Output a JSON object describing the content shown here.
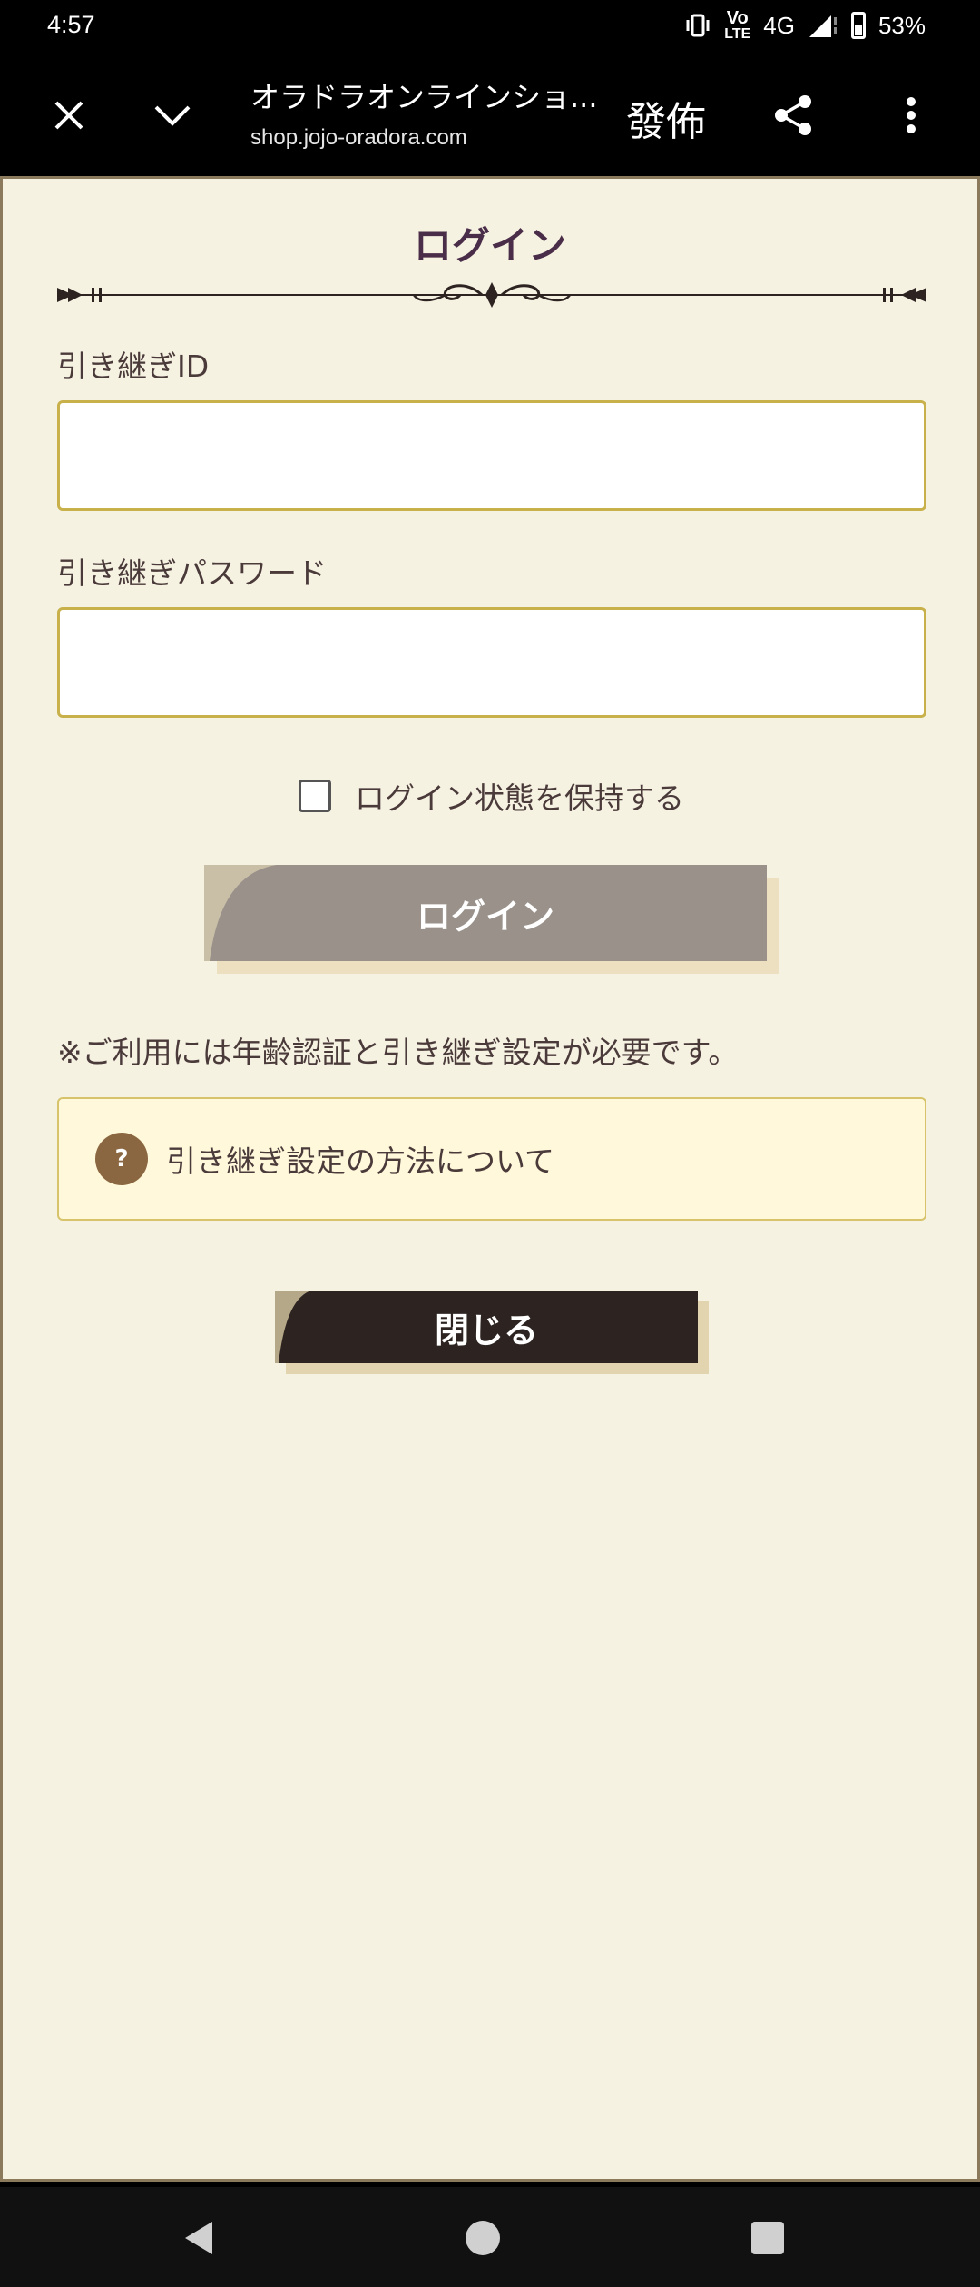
{
  "status_bar": {
    "time": "4:57",
    "network_top": "Vo",
    "network_bottom": "LTE",
    "network_type": "4G",
    "battery": "53%"
  },
  "toolbar": {
    "page_title": "オラドラオンラインショ...",
    "url": "shop.jojo-oradora.com",
    "translate_label": "發佈",
    "icons": [
      "close-icon",
      "chevron-down-icon",
      "share-icon",
      "more-vert-icon"
    ]
  },
  "login": {
    "title": "ログイン",
    "id_label": "引き継ぎID",
    "id_value": "",
    "password_label": "引き継ぎパスワード",
    "password_value": "",
    "remember_label": "ログイン状態を保持する",
    "remember_checked": false,
    "login_button": "ログイン",
    "note": "※ご利用には年齢認証と引き継ぎ設定が必要です。",
    "help_icon": "?",
    "help_label": "引き継ぎ設定の方法について",
    "close_button": "閉じる"
  },
  "colors": {
    "page_bg": "#f6f2e2",
    "title": "#4a2d48",
    "input_border": "#c8b14a",
    "login_button": "#99918a",
    "help_bg": "#fff8da",
    "help_icon": "#8b6741",
    "close_button": "#2d2421"
  },
  "navbar": {
    "icons": [
      "back-icon",
      "home-icon",
      "recents-icon"
    ]
  }
}
